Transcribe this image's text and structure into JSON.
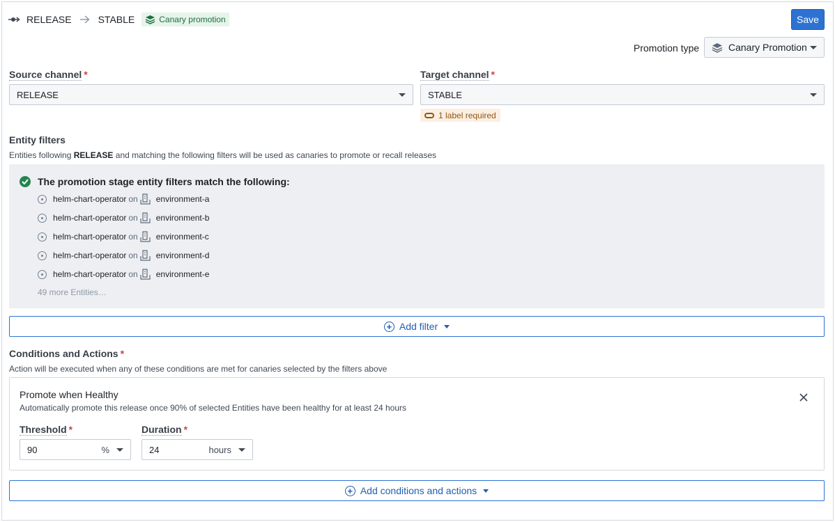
{
  "header": {
    "source": "RELEASE",
    "target": "STABLE",
    "badge": "Canary promotion",
    "save_label": "Save"
  },
  "promotion_type": {
    "label": "Promotion type",
    "value": "Canary Promotion"
  },
  "source_channel": {
    "label": "Source channel",
    "required": "*",
    "value": "RELEASE"
  },
  "target_channel": {
    "label": "Target channel",
    "required": "*",
    "value": "STABLE",
    "label_tag": "1 label required"
  },
  "entity_filters": {
    "title": "Entity filters",
    "desc_prefix": "Entities following",
    "desc_channel": "RELEASE",
    "desc_suffix": "and matching the following filters will be used as canaries to promote or recall releases",
    "match_title": "The promotion stage entity filters match the following:",
    "connector": "on",
    "entities": [
      {
        "name": "helm-chart-operator",
        "env": "environment-a"
      },
      {
        "name": "helm-chart-operator",
        "env": "environment-b"
      },
      {
        "name": "helm-chart-operator",
        "env": "environment-c"
      },
      {
        "name": "helm-chart-operator",
        "env": "environment-d"
      },
      {
        "name": "helm-chart-operator",
        "env": "environment-e"
      }
    ],
    "more": "49 more Entities…",
    "add_filter_label": "Add filter"
  },
  "conditions": {
    "title": "Conditions and Actions",
    "required": "*",
    "desc": "Action will be executed when any of these conditions are met for canaries selected by the filters above",
    "card": {
      "title": "Promote when Healthy",
      "desc": "Automatically promote this release once 90% of selected Entities have been healthy for at least 24 hours",
      "threshold_label": "Threshold",
      "threshold_value": "90",
      "threshold_unit": "%",
      "duration_label": "Duration",
      "duration_value": "24",
      "duration_unit": "hours"
    },
    "add_label": "Add conditions and actions"
  },
  "colors": {
    "primary": "#2d72d2",
    "success": "#238551",
    "warning": "#935610",
    "required": "#cd4246"
  }
}
